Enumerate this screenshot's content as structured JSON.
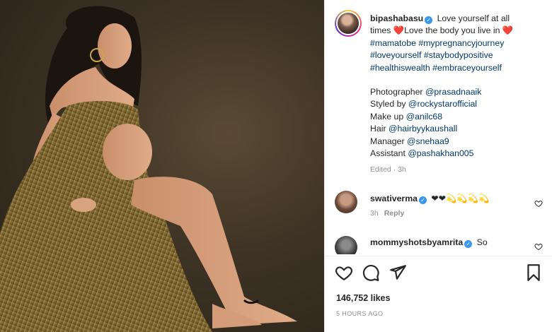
{
  "post": {
    "username": "bipashabasu",
    "caption_lines": [
      {
        "prefix": "Love yourself at all",
        "parts": []
      },
      {
        "text": "times ❤️Love the body you live in ❤️"
      },
      {
        "tags": "#mamatobe #mypregnancyjourney"
      },
      {
        "tags": "#loveyourself #staybodypositive"
      },
      {
        "tags": "#healthiswealth #embraceyourself"
      }
    ],
    "caption_first": "Love yourself at all",
    "caption_second": "times ❤️Love the body you live in ❤️",
    "hashtags": [
      "#mamatobe #mypregnancyjourney",
      "#loveyourself #staybodypositive",
      "#healthiswealth #embraceyourself"
    ],
    "credits": [
      {
        "role": "Photographer",
        "handle": "@prasadnaaik"
      },
      {
        "role": "Styled by",
        "handle": "@rockystarofficial"
      },
      {
        "role": "Make up",
        "handle": "@anilc68"
      },
      {
        "role": "Hair",
        "handle": "@hairbyykaushall"
      },
      {
        "role": "Manager",
        "handle": "@snehaa9"
      },
      {
        "role": "Assistant",
        "handle": "@pashakhan005"
      }
    ],
    "edited": "Edited · 3h"
  },
  "comments": [
    {
      "user": "swativerma",
      "text": "❤❤💫💫💫💫",
      "time": "3h",
      "reply": "Reply",
      "avatar_color": "#6b4a3a"
    },
    {
      "user": "mommyshotsbyamrita",
      "text": "So",
      "time": "",
      "reply": "",
      "avatar_color": "#3a3a3a"
    }
  ],
  "actions": {
    "like_icon": "heart-icon",
    "comment_icon": "comment-icon",
    "share_icon": "share-icon",
    "save_icon": "bookmark-icon"
  },
  "likes": "146,752 likes",
  "timestamp": "5 HOURS AGO",
  "colors": {
    "link": "#00376b",
    "verified": "#3897f0",
    "meta": "#8e8e8e",
    "text": "#262626",
    "dress_gold": "#8a7436"
  }
}
